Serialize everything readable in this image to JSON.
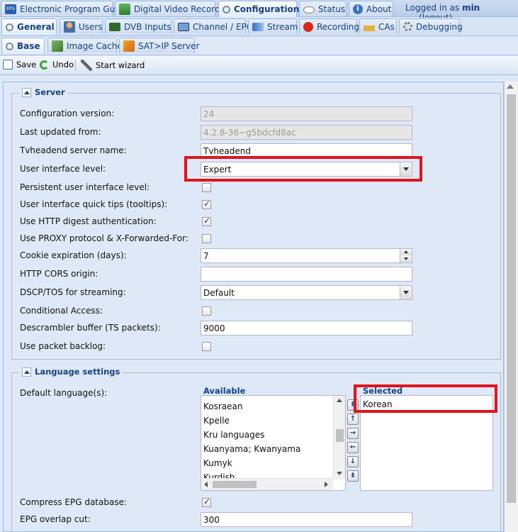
{
  "top_tabs": [
    {
      "label": "Electronic Program Guide",
      "icon": "epg-icon"
    },
    {
      "label": "Digital Video Recorder",
      "icon": "dvr-icon"
    },
    {
      "label": "Configuration",
      "icon": "wrench-icon"
    },
    {
      "label": "Status",
      "icon": "eye-icon"
    },
    {
      "label": "About",
      "icon": "info-icon"
    }
  ],
  "login": {
    "prefix": "Logged in as",
    "user": "min",
    "logout": "(logout)"
  },
  "sub_tabs": [
    {
      "label": "General"
    },
    {
      "label": "Users"
    },
    {
      "label": "DVB Inputs"
    },
    {
      "label": "Channel / EPG"
    },
    {
      "label": "Stream"
    },
    {
      "label": "Recording"
    },
    {
      "label": "CAs"
    },
    {
      "label": "Debugging"
    }
  ],
  "sub_sub_tabs": [
    {
      "label": "Base"
    },
    {
      "label": "Image Cache"
    },
    {
      "label": "SAT>IP Server"
    }
  ],
  "toolbar": {
    "save": "Save",
    "undo": "Undo",
    "wizard": "Start wizard"
  },
  "server": {
    "title": "Server",
    "config_version_label": "Configuration version:",
    "config_version": "24",
    "last_updated_label": "Last updated from:",
    "last_updated": "4.2.8-36~g5bdcfd8ac",
    "server_name_label": "Tvheadend server name:",
    "server_name": "Tvheadend",
    "ui_level_label": "User interface level:",
    "ui_level": "Expert",
    "persistent_ui_label": "Persistent user interface level:",
    "persistent_ui": false,
    "quick_tips_label": "User interface quick tips (tooltips):",
    "quick_tips": true,
    "digest_auth_label": "Use HTTP digest authentication:",
    "digest_auth": true,
    "proxy_label": "Use PROXY protocol & X-Forwarded-For:",
    "proxy": false,
    "cookie_label": "Cookie expiration (days):",
    "cookie": "7",
    "cors_label": "HTTP CORS origin:",
    "cors": "",
    "dscp_label": "DSCP/TOS for streaming:",
    "dscp": "Default",
    "cond_access_label": "Conditional Access:",
    "cond_access": false,
    "descrambler_label": "Descrambler buffer (TS packets):",
    "descrambler": "9000",
    "backlog_label": "Use packet backlog:",
    "backlog": false
  },
  "language": {
    "title": "Language settings",
    "default_label": "Default language(s):",
    "available_header": "Available",
    "available": [
      "Kosraean",
      "Kpelle",
      "Kru languages",
      "Kuanyama; Kwanyama",
      "Kumyk",
      "Kurdish"
    ],
    "selected_header": "Selected",
    "selected": [
      "Korean"
    ],
    "compress_label": "Compress EPG database:",
    "compress": true,
    "overlap_label": "EPG overlap cut:",
    "overlap": "300"
  },
  "colors": {
    "accent": "#15428b",
    "highlight_box": "#e0141e",
    "panel_bg": "#dfe8f6"
  }
}
